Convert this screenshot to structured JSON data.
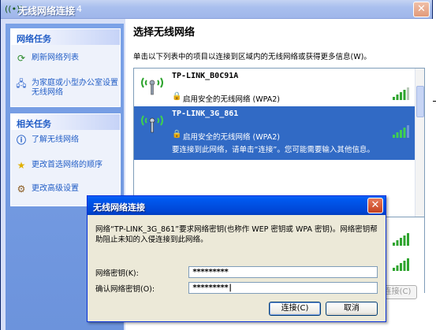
{
  "window": {
    "title": "无线网络连接",
    "title_suffix": "4",
    "close_glyph": "✕"
  },
  "sidebar": {
    "network_tasks": {
      "title": "网络任务",
      "items": [
        {
          "label": "刷新网络列表",
          "icon": "refresh-icon"
        },
        {
          "label": "为家庭或小型办公室设置无线网络",
          "icon": "network-setup-icon"
        }
      ]
    },
    "related_tasks": {
      "title": "相关任务",
      "items": [
        {
          "label": "了解无线网络",
          "icon": "info-icon"
        },
        {
          "label": "更改首选网络的顺序",
          "icon": "star-icon"
        },
        {
          "label": "更改高级设置",
          "icon": "settings-icon"
        }
      ]
    }
  },
  "content": {
    "heading": "选择无线网络",
    "description": "单击以下列表中的项目以连接到区域内的无线网络或获得更多信息(W)。",
    "networks": [
      {
        "ssid": "TP-LINK_B0C91A",
        "security": "启用安全的无线网络 (WPA2)",
        "message": "",
        "selected": false,
        "signal": 0.8
      },
      {
        "ssid": "TP-LINK_3G_861",
        "security": "启用安全的无线网络 (WPA2)",
        "message": "要连接到此网络，请单击“连接”。您可能需要输入其他信息。",
        "selected": true,
        "signal": 0.8
      }
    ],
    "connect_button_behind": "连接(C)"
  },
  "dialog": {
    "title": "无线网络连接",
    "message": "网络“TP-LINK_3G_861”要求网络密钥(也称作 WEP 密钥或 WPA 密钥)。网络密钥帮助阻止未知的入侵连接到此网络。",
    "key_label": "网络密钥(K):",
    "key_value": "*********",
    "confirm_label": "确认网络密钥(O):",
    "confirm_value": "*********|",
    "connect_label": "连接(C)",
    "cancel_label": "取消"
  },
  "colors": {
    "selection": "#316ac5",
    "task_link": "#215dc6",
    "dialog_title": "#0046d5",
    "signal_green": "#2ea42e"
  }
}
